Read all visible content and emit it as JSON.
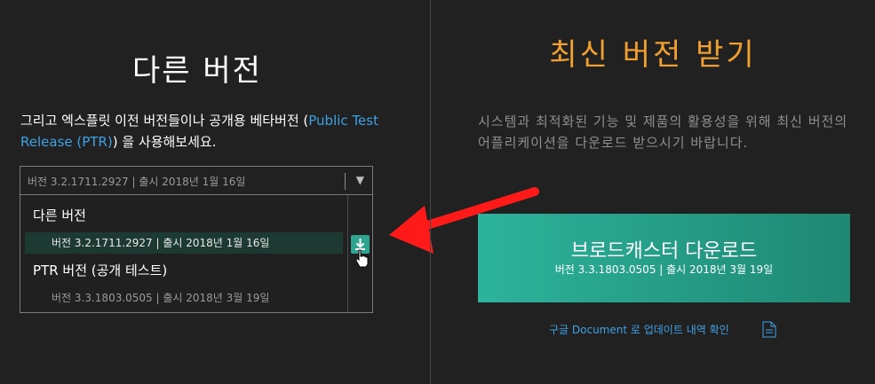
{
  "left": {
    "title": "다른 버전",
    "intro_text": "그리고 엑스플릿 이전 버전들이나 공개용 베타버전 (",
    "intro_link": "Public Test Release (PTR)",
    "intro_suffix": ") 을 사용해보세요.",
    "select": {
      "value": "버전 3.2.1711.2927 | 출시 2018년 1월 16일"
    },
    "dropdown": {
      "group_other": "다른 버전",
      "option_current": "버전 3.2.1711.2927 | 출시 2018년 1월 16일",
      "group_ptr": "PTR 버전 (공개 테스트)",
      "option_ptr": "버전 3.3.1803.0505 | 출시 2018년 3월 19일"
    }
  },
  "right": {
    "title": "최신 버전 받기",
    "description": "시스템과 최적화된 기능 및 제품의 활용성을 위해 최신 버전의 어플리케이션을 다운로드 받으시기 바랍니다.",
    "download_button": {
      "label": "브로드캐스터 다운로드",
      "sub": "버전 3.3.1803.0505 | 출시 2018년 3월 19일"
    },
    "doc_link": "구글 Document 로 업데이트 내역 확인"
  },
  "colors": {
    "background": "#212121",
    "accent_orange": "#f0a030",
    "accent_teal": "#2db39c",
    "link_blue": "#3da2e6",
    "annotation_arrow": "#ff1a1a"
  },
  "icons": [
    "chevron-down-icon",
    "download-icon",
    "hand-cursor-icon",
    "document-icon",
    "red-arrow-annotation"
  ]
}
